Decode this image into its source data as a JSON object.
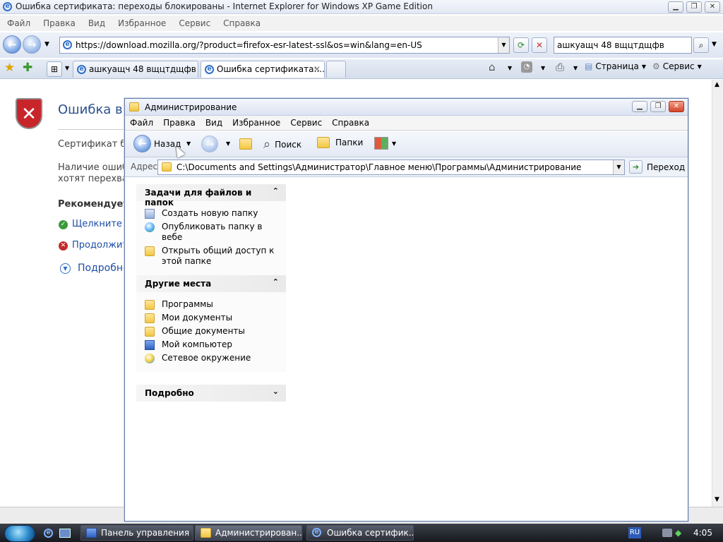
{
  "ie": {
    "title": "Ошибка сертификата: переходы блокированы - Internet Explorer for Windows XP Game Edition",
    "menu": [
      "Файл",
      "Правка",
      "Вид",
      "Избранное",
      "Сервис",
      "Справка"
    ],
    "address": "https://download.mozilla.org/?product=firefox-esr-latest-ssl&os=win&lang=en-US",
    "search_value": "ашкуащч 48 вщцтдщфв",
    "tabs": [
      {
        "label": "ашкуащч 48 вщцтдщфв - ..."
      },
      {
        "label": "Ошибка сертификата:..."
      }
    ],
    "command_bar": {
      "page": "Страница",
      "tools": "Сервис"
    }
  },
  "error_page": {
    "heading": "Ошибка в с",
    "line1": "Сертификат бло",
    "line2": "Наличие ошиб",
    "line3": "хотят перехва",
    "recommend": "Рекомендует",
    "link_close": "Щелкните з",
    "link_continue": "Продолжит",
    "link_more": "Подробно"
  },
  "explorer": {
    "title": "Администрирование",
    "menu": [
      "Файл",
      "Правка",
      "Вид",
      "Избранное",
      "Сервис",
      "Справка"
    ],
    "toolbar": {
      "back": "Назад",
      "search": "Поиск",
      "folders": "Папки"
    },
    "address_label": "Адрес:",
    "address": "C:\\Documents and Settings\\Администратор\\Главное меню\\Программы\\Администрирование",
    "go": "Переход",
    "tasks_panel": {
      "title": "Задачи для файлов и папок",
      "items": [
        "Создать новую папку",
        "Опубликовать папку в вебе",
        "Открыть общий доступ к этой папке"
      ]
    },
    "places_panel": {
      "title": "Другие места",
      "items": [
        "Программы",
        "Мои документы",
        "Общие документы",
        "Мой компьютер",
        "Сетевое окружение"
      ]
    },
    "details_panel": {
      "title": "Подробно"
    }
  },
  "taskbar": {
    "buttons": [
      "Панель управления",
      "Администрирован...",
      "Ошибка сертифик..."
    ],
    "language": "RU",
    "clock": "4:05"
  }
}
